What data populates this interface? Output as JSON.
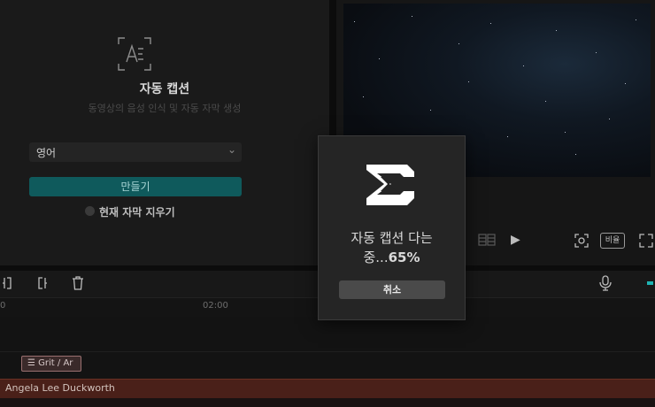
{
  "caption_panel": {
    "title": "자동 캡션",
    "description": "동영상의 음성 인식 및 자동 자막 생성",
    "language_value": "영어",
    "create_button": "만들기",
    "clear_checkbox_label": "현재 자막 지우기"
  },
  "player": {
    "ratio_button": "비율"
  },
  "timeline": {
    "ticks": [
      "0",
      "02:00"
    ],
    "caption_clip_label": "Grit / Ar",
    "audio_clip_label": "Angela Lee Duckworth"
  },
  "modal": {
    "progress_line1": "자동 캡션 다는",
    "progress_prefix": "중...",
    "progress_percent": "65%",
    "progress_value": 0.65,
    "cancel_button": "취소"
  },
  "colors": {
    "accent": "#0f5a5c",
    "audio_clip": "#4a2019",
    "timeline_marker": "#1fb3b3"
  },
  "icons": [
    "auto-caption-icon",
    "chevron-down-icon",
    "grid-icon",
    "play-icon",
    "fullscreen-icon",
    "expand-icon",
    "split-left-icon",
    "split-right-icon",
    "delete-icon",
    "microphone-icon",
    "capcut-logo-icon"
  ]
}
